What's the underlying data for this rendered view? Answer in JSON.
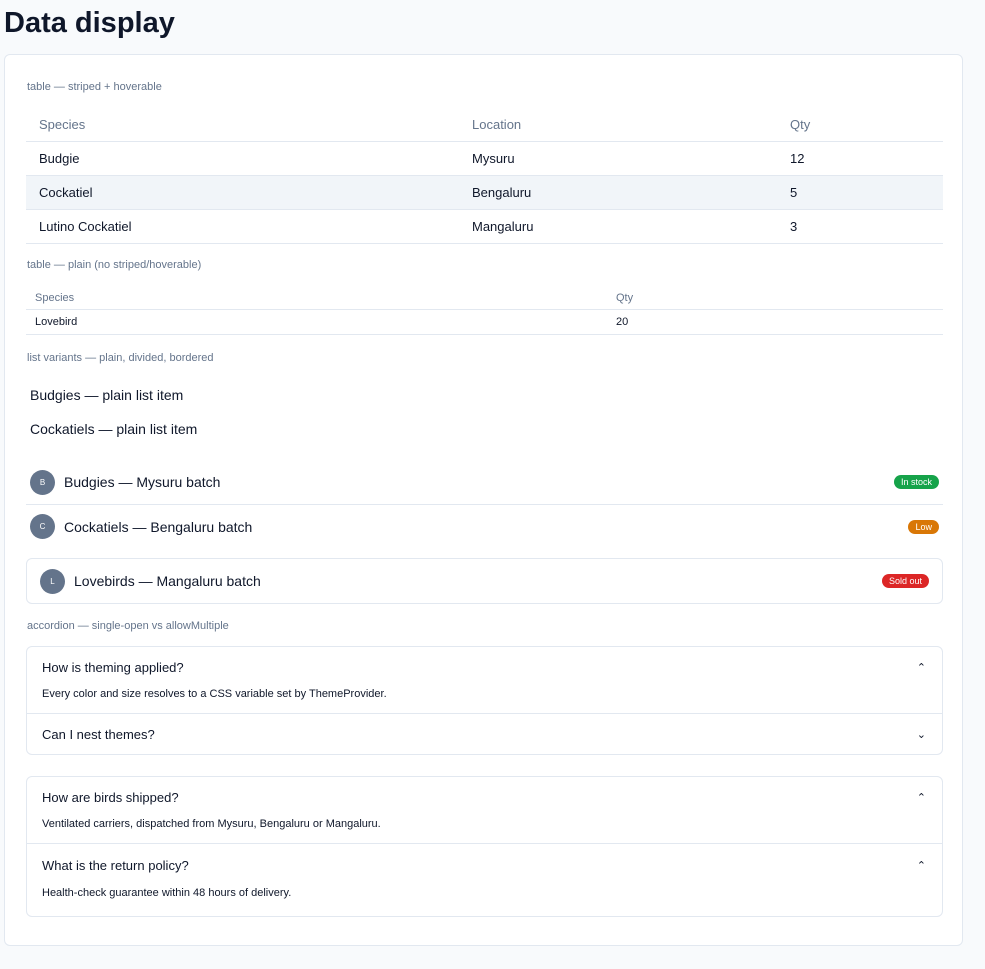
{
  "page": {
    "title": "Data display"
  },
  "colors": {
    "success": "#16a34a",
    "warning": "#d97706",
    "danger": "#dc2626",
    "avatar": "#64748b",
    "stripe": "#f1f5f9"
  },
  "sections": {
    "table1_label": "table — striped + hoverable",
    "table2_label": "table — plain (no striped/hoverable)",
    "list_label": "list variants — plain, divided, bordered",
    "accordion_label": "accordion — single-open vs allowMultiple"
  },
  "table1": {
    "headers": [
      "Species",
      "Location",
      "Qty"
    ],
    "rows": [
      [
        "Budgie",
        "Mysuru",
        "12"
      ],
      [
        "Cockatiel",
        "Bengaluru",
        "5"
      ],
      [
        "Lutino Cockatiel",
        "Mangaluru",
        "3"
      ]
    ]
  },
  "table2": {
    "headers": [
      "Species",
      "Qty"
    ],
    "rows": [
      [
        "Lovebird",
        "20"
      ]
    ]
  },
  "plain_list": [
    "Budgies — plain list item",
    "Cockatiels — plain list item"
  ],
  "divided_list": [
    {
      "initial": "B",
      "text": "Budgies — Mysuru batch",
      "badge": "In stock"
    },
    {
      "initial": "C",
      "text": "Cockatiels — Bengaluru batch",
      "badge": "Low"
    }
  ],
  "bordered_list": [
    {
      "initial": "L",
      "text": "Lovebirds — Mangaluru batch",
      "badge": "Sold out"
    }
  ],
  "accordion1": [
    {
      "title": "How is theming applied?",
      "body": "Every color and size resolves to a CSS variable set by ThemeProvider.",
      "open": true,
      "chevron": "⌃"
    },
    {
      "title": "Can I nest themes?",
      "open": false,
      "chevron": "⌄"
    }
  ],
  "accordion2": [
    {
      "title": "How are birds shipped?",
      "body": "Ventilated carriers, dispatched from Mysuru, Bengaluru or Mangaluru.",
      "open": true,
      "chevron": "⌃"
    },
    {
      "title": "What is the return policy?",
      "body": "Health-check guarantee within 48 hours of delivery.",
      "open": true,
      "chevron": "⌃"
    }
  ]
}
